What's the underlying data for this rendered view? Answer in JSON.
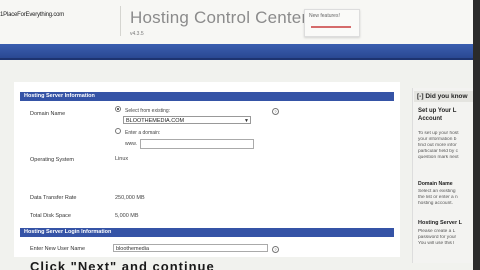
{
  "header": {
    "logo_text": "1PlaceForEverything.com",
    "title": "Hosting Control Center",
    "version": "v4.3.5",
    "badge_text": "New features!"
  },
  "form": {
    "section1_title": "Hosting Server Information",
    "domain_label": "Domain Name",
    "radio_existing_label": "Select from existing:",
    "selected_domain": "BLOOTHEMEDIA.COM",
    "radio_enter_label": "Enter a domain:",
    "enter_prefix": "www.",
    "os_label": "Operating System",
    "os_value": "Linux",
    "transfer_label": "Data Transfer Rate",
    "transfer_value": "250,000 MB",
    "disk_label": "Total Disk Space",
    "disk_value": "5,000 MB",
    "section2_title": "Hosting Server Login Information",
    "username_label": "Enter New User Name",
    "username_value": "bloothemedia",
    "help_symbol": "?"
  },
  "help": {
    "header": "Did you know",
    "heading1": "Set up Your L",
    "heading1b": "Account",
    "lines1": [
      "To set up your host",
      "your information b",
      "find out more infor",
      "particular field by c",
      "question mark next"
    ],
    "heading2": "Domain Name",
    "lines2": [
      "Select an existing",
      "the list or enter a n",
      "hosting account."
    ],
    "heading3": "Hosting Server L",
    "lines3": [
      "Please create a L",
      "password for your",
      "You will use this l"
    ]
  },
  "caption": "Click \"Next\" and continue"
}
